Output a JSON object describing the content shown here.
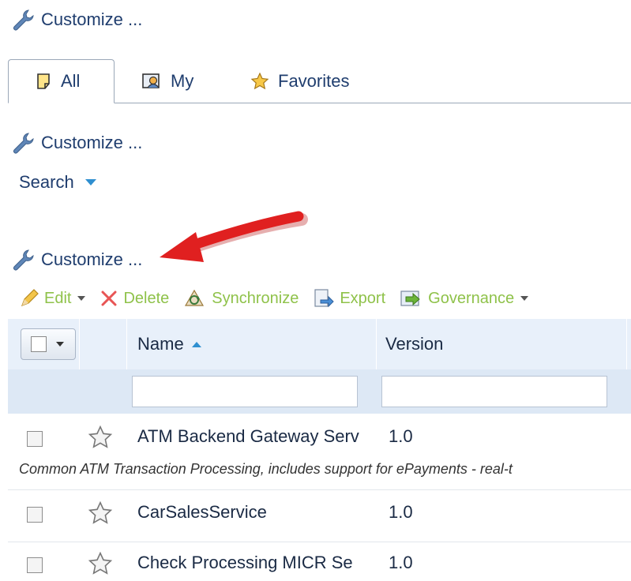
{
  "customize_top": "Customize ...",
  "tabs": [
    {
      "label": "All",
      "icon": "note-icon",
      "active": true
    },
    {
      "label": "My",
      "icon": "user-card-icon",
      "active": false
    },
    {
      "label": "Favorites",
      "icon": "star-icon",
      "active": false
    }
  ],
  "customize_mid": "Customize ...",
  "search_label": "Search",
  "customize_grid": "Customize ...",
  "toolbar": {
    "edit": "Edit",
    "delete": "Delete",
    "synchronize": "Synchronize",
    "export": "Export",
    "governance": "Governance"
  },
  "grid": {
    "columns": [
      "Name",
      "Version"
    ],
    "rows": [
      {
        "name": "ATM Backend Gateway Serv",
        "version": "1.0",
        "description": "Common ATM Transaction Processing, includes support for ePayments - real-t"
      },
      {
        "name": "CarSalesService",
        "version": "1.0",
        "description": ""
      },
      {
        "name": "Check Processing MICR Se",
        "version": "1.0",
        "description": ""
      }
    ]
  },
  "colors": {
    "link": "#1f3d6e",
    "toolbar_disabled": "#8fc24a",
    "arrow": "#e02020",
    "header_bg": "#e8f0fa"
  }
}
